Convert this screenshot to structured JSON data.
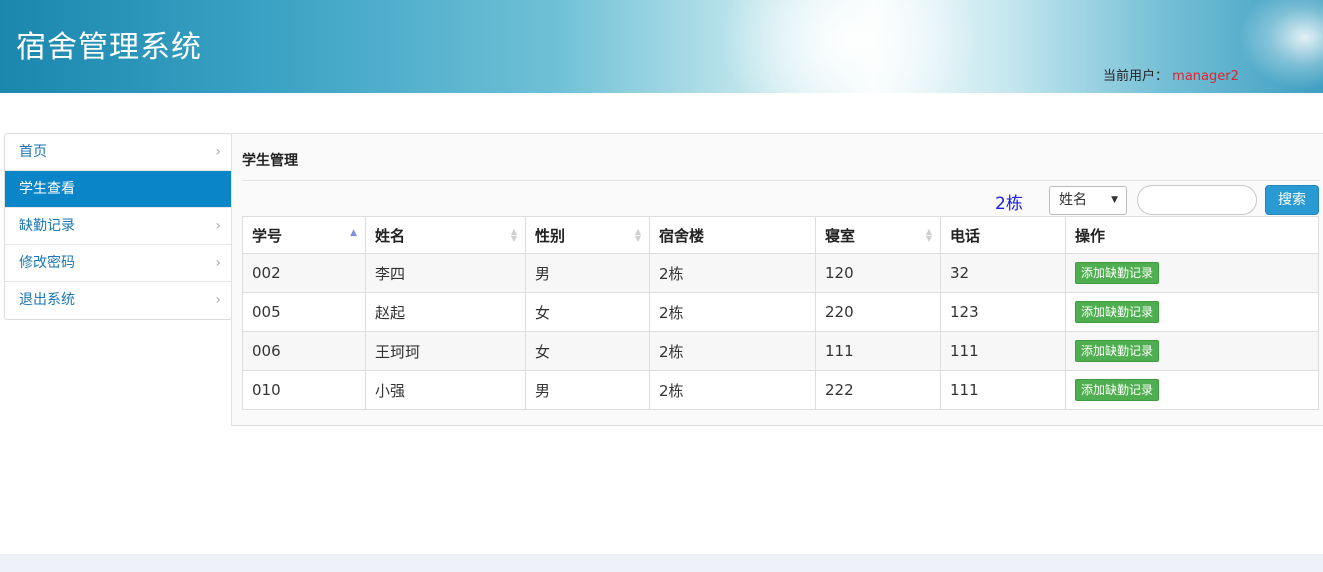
{
  "header": {
    "title": "宿舍管理系统",
    "current_user_label": "当前用户：",
    "current_user": "manager2"
  },
  "sidebar": {
    "items": [
      {
        "label": "首页",
        "active": false
      },
      {
        "label": "学生查看",
        "active": true
      },
      {
        "label": "缺勤记录",
        "active": false
      },
      {
        "label": "修改密码",
        "active": false
      },
      {
        "label": "退出系统",
        "active": false
      }
    ]
  },
  "main": {
    "panel_title": "学生管理",
    "building": "2栋",
    "search": {
      "field_selected": "姓名",
      "value": "",
      "button_label": "搜索"
    },
    "table": {
      "columns": [
        "学号",
        "姓名",
        "性别",
        "宿舍楼",
        "寝室",
        "电话",
        "操作"
      ],
      "rows": [
        {
          "id": "002",
          "name": "李四",
          "gender": "男",
          "building": "2栋",
          "room": "120",
          "phone": "32",
          "action": "添加缺勤记录"
        },
        {
          "id": "005",
          "name": "赵起",
          "gender": "女",
          "building": "2栋",
          "room": "220",
          "phone": "123",
          "action": "添加缺勤记录"
        },
        {
          "id": "006",
          "name": "王珂珂",
          "gender": "女",
          "building": "2栋",
          "room": "111",
          "phone": "111",
          "action": "添加缺勤记录"
        },
        {
          "id": "010",
          "name": "小强",
          "gender": "男",
          "building": "2栋",
          "room": "222",
          "phone": "111",
          "action": "添加缺勤记录"
        }
      ]
    }
  },
  "colors": {
    "accent": "#0a85c7",
    "user_name": "#e0262b",
    "building_text": "#1d1de0",
    "action_button": "#4fae4f"
  }
}
